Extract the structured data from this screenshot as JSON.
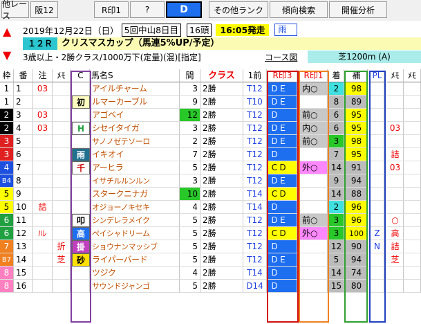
{
  "toolbar": {
    "buttons": [
      {
        "label": "他レース"
      },
      {
        "label": "阪12"
      },
      {
        "label": "R印1"
      },
      {
        "label": "?"
      },
      {
        "label": "D"
      },
      {
        "label": "その他ランク"
      },
      {
        "label": "傾向検索"
      },
      {
        "label": "開催分析"
      }
    ]
  },
  "race": {
    "date": "2019年12月22日（日）",
    "meeting": "5回中山8日目",
    "heads": "16頭",
    "start": "16:05発走",
    "weather": "雨",
    "number": "１２Ｒ",
    "name": "クリスマスカップ（馬連5%UP/予定）",
    "conditions": "3歳以上・2勝クラス/1000万下(定量)(混)[指定]",
    "course_label": "コース図",
    "course": "芝1200m (A)"
  },
  "headers": [
    "枠",
    "番",
    "注",
    "ﾒﾓ",
    "C",
    "馬名S",
    "間",
    "クラス",
    "1前",
    "R印3",
    "R印1",
    "着",
    "補",
    "PL",
    "ﾒﾓ",
    "ﾒﾓ"
  ],
  "colors": {
    "red_box": "#d01010",
    "orange_box": "#f08020",
    "green_box": "#30a030",
    "blue_box": "#2040c0",
    "purple_box": "#8040a0",
    "blue_cell": "#1e6ff0",
    "yellow_cell": "#ffff00",
    "pink_cell": "#ff88ff",
    "gray_cell": "#c8c8c8",
    "cyan_cell": "#40e0e0",
    "green_cell": "#28c828"
  },
  "rows": [
    {
      "waku": "1",
      "ban": "1",
      "chu": "03",
      "memo": "",
      "c": "",
      "name": "アイルチャーム",
      "kan": "3",
      "cls": "2勝",
      "prev": "T12",
      "r3": "ＤＥ",
      "r1": "内○",
      "chaku": "2",
      "ho": "98",
      "pl": "",
      "m2": "",
      "m3": ""
    },
    {
      "waku": "1",
      "ban": "2",
      "chu": "",
      "memo": "",
      "c": "初",
      "name": "ルマーカーブル",
      "kan": "9",
      "cls": "2勝",
      "prev": "T10",
      "r3": "ＤＥ",
      "r1": "",
      "chaku": "8",
      "ho": "89",
      "pl": "",
      "m2": "",
      "m3": ""
    },
    {
      "waku": "2",
      "ban": "3",
      "chu": "03",
      "memo": "",
      "c": "",
      "name": "アゴベイ",
      "kan": "12",
      "cls": "2勝",
      "prev": "T12",
      "r3": "Ｄ",
      "r1": "前○",
      "chaku": "6",
      "ho": "95",
      "pl": "",
      "m2": "",
      "m3": ""
    },
    {
      "waku": "2",
      "ban": "4",
      "chu": "03",
      "memo": "",
      "c": "H",
      "name": "シセイタイガ",
      "kan": "3",
      "cls": "2勝",
      "prev": "T12",
      "r3": "ＤＥ",
      "r1": "内○",
      "chaku": "6",
      "ho": "95",
      "pl": "",
      "m2": "03",
      "m3": ""
    },
    {
      "waku": "3",
      "ban": "5",
      "chu": "",
      "memo": "",
      "c": "",
      "name": "サノノゼテソーロ",
      "kan": "2",
      "cls": "2勝",
      "prev": "T12",
      "r3": "ＤＥ",
      "r1": "前○",
      "chaku": "3",
      "ho": "98",
      "pl": "",
      "m2": "",
      "m3": ""
    },
    {
      "waku": "3",
      "ban": "6",
      "chu": "",
      "memo": "",
      "c": "雨",
      "name": "イキオイ",
      "kan": "7",
      "cls": "2勝",
      "prev": "T12",
      "r3": "Ｄ",
      "r1": "",
      "chaku": "7",
      "ho": "95",
      "pl": "",
      "m2": "詰",
      "m3": ""
    },
    {
      "waku": "4",
      "ban": "7",
      "chu": "",
      "memo": "",
      "c": "千",
      "name": "アーヒラ",
      "kan": "5",
      "cls": "2勝",
      "prev": "T12",
      "r3": "ＣＤ",
      "r1": "外○",
      "chaku": "14",
      "ho": "91",
      "pl": "",
      "m2": "03",
      "m3": ""
    },
    {
      "waku": "B4",
      "ban": "8",
      "chu": "",
      "memo": "",
      "c": "",
      "name": "イサチルルンルン",
      "kan": "3",
      "cls": "2勝",
      "prev": "T12",
      "r3": "ＤＥ",
      "r1": "",
      "chaku": "9",
      "ho": "94",
      "pl": "",
      "m2": "",
      "m3": ""
    },
    {
      "waku": "5",
      "ban": "9",
      "chu": "",
      "memo": "",
      "c": "",
      "name": "スタークニナガ",
      "kan": "10",
      "cls": "2勝",
      "prev": "T14",
      "r3": "ＣＤ",
      "r1": "",
      "chaku": "14",
      "ho": "88",
      "pl": "",
      "m2": "",
      "m3": ""
    },
    {
      "waku": "5",
      "ban": "10",
      "chu": "詰",
      "memo": "",
      "c": "",
      "name": "オジョーノキセキ",
      "kan": "4",
      "cls": "2勝",
      "prev": "T14",
      "r3": "Ｄ",
      "r1": "",
      "chaku": "2",
      "ho": "96",
      "pl": "",
      "m2": "",
      "m3": ""
    },
    {
      "waku": "6",
      "ban": "11",
      "chu": "",
      "memo": "",
      "c": "叩",
      "name": "シンデレラメイク",
      "kan": "5",
      "cls": "2勝",
      "prev": "T12",
      "r3": "ＤＥ",
      "r1": "前○",
      "chaku": "3",
      "ho": "96",
      "pl": "",
      "m2": "○",
      "m3": ""
    },
    {
      "waku": "6",
      "ban": "12",
      "chu": "ﾊﾚ",
      "memo": "",
      "c": "高",
      "name": "ペイシャドリーム",
      "kan": "5",
      "cls": "2勝",
      "prev": "T12",
      "r3": "ＣＤ",
      "r1": "外○",
      "chaku": "3",
      "ho": "100",
      "pl": "Z",
      "m2": "高",
      "m3": ""
    },
    {
      "waku": "7",
      "ban": "13",
      "chu": "",
      "memo": "折",
      "c": "掛",
      "name": "ショウナンマッシブ",
      "kan": "5",
      "cls": "2勝",
      "prev": "T12",
      "r3": "Ｄ",
      "r1": "",
      "chaku": "12",
      "ho": "90",
      "pl": "N",
      "m2": "詰",
      "m3": ""
    },
    {
      "waku": "B7",
      "ban": "14",
      "chu": "",
      "memo": "芝",
      "c": "砂",
      "name": "ライパーバード",
      "kan": "5",
      "cls": "2勝",
      "prev": "T12",
      "r3": "ＤＥ",
      "r1": "",
      "chaku": "5",
      "ho": "94",
      "pl": "",
      "m2": "芝",
      "m3": ""
    },
    {
      "waku": "8",
      "ban": "15",
      "chu": "",
      "memo": "",
      "c": "",
      "name": "ツジク",
      "kan": "4",
      "cls": "2勝",
      "prev": "T14",
      "r3": "Ｄ",
      "r1": "",
      "chaku": "14",
      "ho": "74",
      "pl": "",
      "m2": "",
      "m3": ""
    },
    {
      "waku": "8",
      "ban": "16",
      "chu": "",
      "memo": "",
      "c": "",
      "name": "サウンドジャンゴ",
      "kan": "5",
      "cls": "2勝",
      "prev": "D14",
      "r3": "Ｄ",
      "r1": "",
      "chaku": "15",
      "ho": "80",
      "pl": "",
      "m2": "",
      "m3": ""
    }
  ]
}
